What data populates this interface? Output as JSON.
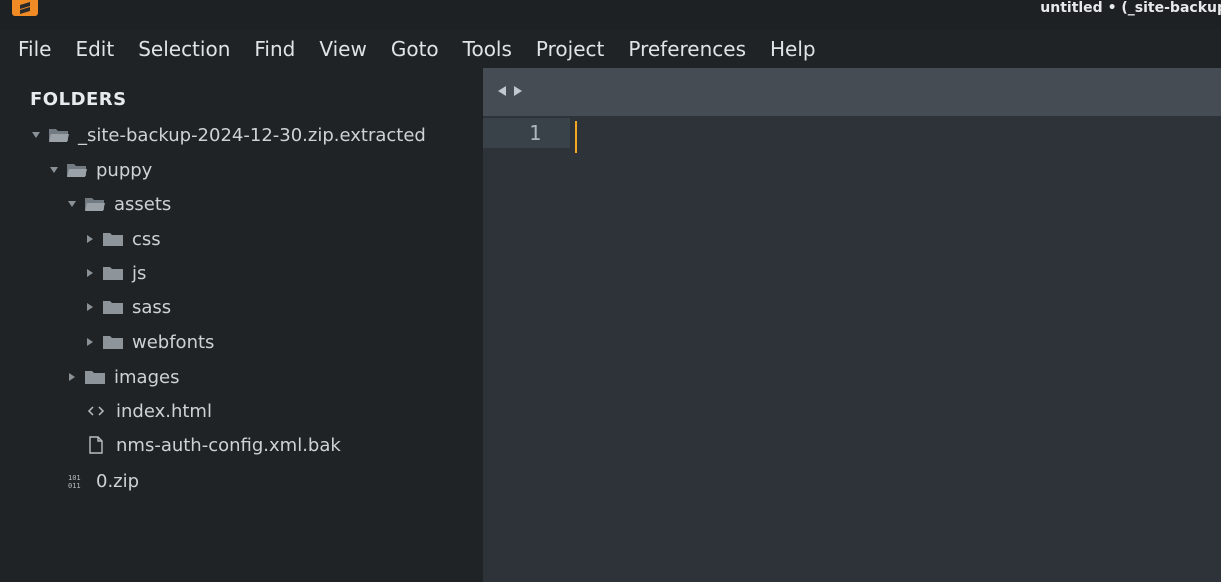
{
  "window": {
    "title": "untitled • (_site-backup"
  },
  "menu": {
    "items": [
      "File",
      "Edit",
      "Selection",
      "Find",
      "View",
      "Goto",
      "Tools",
      "Project",
      "Preferences",
      "Help"
    ]
  },
  "sidebar": {
    "title": "FOLDERS",
    "tree": [
      {
        "label": "_site-backup-2024-12-30.zip.extracted",
        "type": "folder-open",
        "expanded": true
      },
      {
        "label": "puppy",
        "type": "folder-open",
        "expanded": true
      },
      {
        "label": "assets",
        "type": "folder-open",
        "expanded": true
      },
      {
        "label": "css",
        "type": "folder",
        "expanded": false
      },
      {
        "label": "js",
        "type": "folder",
        "expanded": false
      },
      {
        "label": "sass",
        "type": "folder",
        "expanded": false
      },
      {
        "label": "webfonts",
        "type": "folder",
        "expanded": false
      },
      {
        "label": "images",
        "type": "folder",
        "expanded": false
      },
      {
        "label": "index.html",
        "type": "html-file"
      },
      {
        "label": "nms-auth-config.xml.bak",
        "type": "file"
      },
      {
        "label": "0.zip",
        "type": "binary-file"
      }
    ]
  },
  "editor": {
    "line_numbers": [
      "1"
    ],
    "colors": {
      "caret": "#f5a623",
      "background": "#2d3338",
      "tabbar": "#454c53"
    }
  },
  "icons": {
    "app": "sublime-text-icon",
    "tab_nav": [
      "chevron-left-icon",
      "chevron-right-icon"
    ]
  }
}
